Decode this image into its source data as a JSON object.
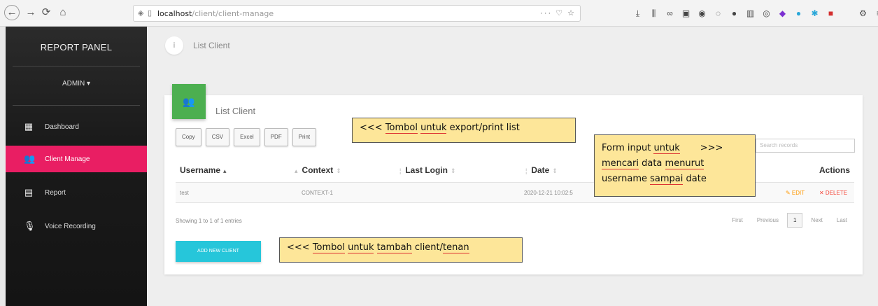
{
  "browser": {
    "back": "←",
    "forward": "→",
    "reload": "⟳",
    "home": "⌂",
    "url_host": "localhost",
    "url_path": "/client/client-manage",
    "url_menu": "··· ♡ ☆",
    "icons": [
      "download-icon",
      "library-icon",
      "reading-icon",
      "container-icon",
      "vpn-icon",
      "ghost-icon",
      "grid-icon",
      "circle-icon",
      "puzzle-icon",
      "dot-icon",
      "star-icon",
      "flag-icon",
      "blank",
      "settings-icon",
      "menu-icon"
    ]
  },
  "sidebar": {
    "brand": "REPORT PANEL",
    "user_menu": "ADMIN ▾",
    "items": [
      {
        "label": "Dashboard",
        "icon": "▦"
      },
      {
        "label": "Client Manage",
        "icon": "👥"
      },
      {
        "label": "Report",
        "icon": "▤"
      },
      {
        "label": "Voice Recording",
        "icon": "🎙"
      }
    ]
  },
  "breadcrumb": {
    "icon": "i",
    "text": "List Client"
  },
  "card": {
    "icon": "👥",
    "title": "List Client",
    "export_buttons": [
      "Copy",
      "CSV",
      "Excel",
      "PDF",
      "Print"
    ],
    "search_placeholder": "Search records",
    "columns": {
      "username": "Username",
      "context": "Context",
      "last_login": "Last Login",
      "date": "Date",
      "actions": "Actions"
    },
    "sort_asc": "▴",
    "sort_both": "⇕",
    "rows": [
      {
        "username": "test",
        "context": "CONTEXT-1",
        "last_login": "",
        "date": "2020-12-21 10:02:5",
        "edit": "✎ EDIT",
        "delete": "✕ DELETE"
      }
    ],
    "info": "Showing 1 to 1 of 1 entries",
    "pager": [
      "First",
      "Previous",
      "1",
      "Next",
      "Last"
    ],
    "add_button": "ADD NEW CLIENT"
  },
  "notes": {
    "export": {
      "prefix": "<<< ",
      "w1": "Tombol",
      "w2": "untuk",
      "rest": " export/print list"
    },
    "search": {
      "l1a": "Form input ",
      "l1b": "untuk",
      "l1c": "       >>>",
      "l2a": "mencari",
      "l2b": " data ",
      "l2c": "menurut",
      "l3a": "username ",
      "l3b": "sampai",
      "l3c": " date"
    },
    "add": {
      "prefix": "<<< ",
      "w1": "Tombol",
      "w2": "untuk",
      "w3": "tambah",
      "rest": " client/",
      "w4": "tenan"
    }
  }
}
